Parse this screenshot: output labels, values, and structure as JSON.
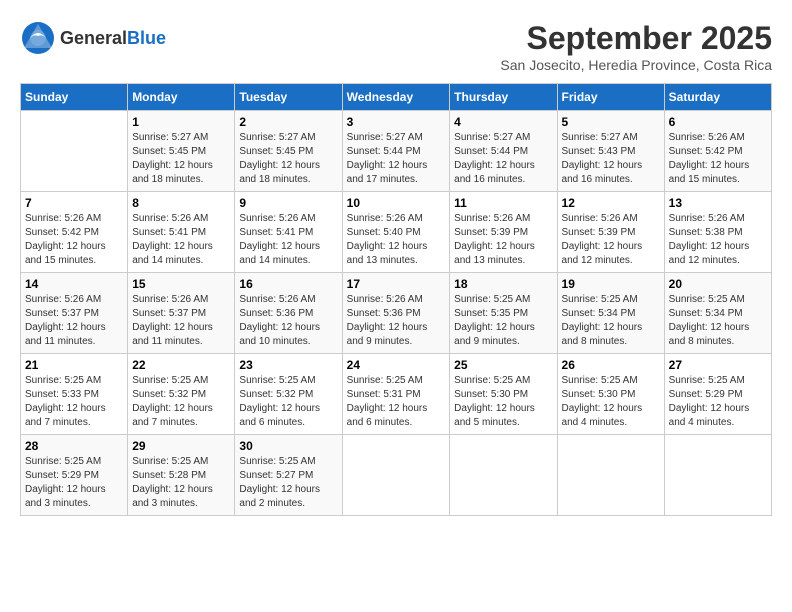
{
  "header": {
    "logo": {
      "text_general": "General",
      "text_blue": "Blue"
    },
    "title": "September 2025",
    "subtitle": "San Josecito, Heredia Province, Costa Rica"
  },
  "calendar": {
    "days_of_week": [
      "Sunday",
      "Monday",
      "Tuesday",
      "Wednesday",
      "Thursday",
      "Friday",
      "Saturday"
    ],
    "weeks": [
      [
        {
          "day": "",
          "info": ""
        },
        {
          "day": "1",
          "info": "Sunrise: 5:27 AM\nSunset: 5:45 PM\nDaylight: 12 hours\nand 18 minutes."
        },
        {
          "day": "2",
          "info": "Sunrise: 5:27 AM\nSunset: 5:45 PM\nDaylight: 12 hours\nand 18 minutes."
        },
        {
          "day": "3",
          "info": "Sunrise: 5:27 AM\nSunset: 5:44 PM\nDaylight: 12 hours\nand 17 minutes."
        },
        {
          "day": "4",
          "info": "Sunrise: 5:27 AM\nSunset: 5:44 PM\nDaylight: 12 hours\nand 16 minutes."
        },
        {
          "day": "5",
          "info": "Sunrise: 5:27 AM\nSunset: 5:43 PM\nDaylight: 12 hours\nand 16 minutes."
        },
        {
          "day": "6",
          "info": "Sunrise: 5:26 AM\nSunset: 5:42 PM\nDaylight: 12 hours\nand 15 minutes."
        }
      ],
      [
        {
          "day": "7",
          "info": "Sunrise: 5:26 AM\nSunset: 5:42 PM\nDaylight: 12 hours\nand 15 minutes."
        },
        {
          "day": "8",
          "info": "Sunrise: 5:26 AM\nSunset: 5:41 PM\nDaylight: 12 hours\nand 14 minutes."
        },
        {
          "day": "9",
          "info": "Sunrise: 5:26 AM\nSunset: 5:41 PM\nDaylight: 12 hours\nand 14 minutes."
        },
        {
          "day": "10",
          "info": "Sunrise: 5:26 AM\nSunset: 5:40 PM\nDaylight: 12 hours\nand 13 minutes."
        },
        {
          "day": "11",
          "info": "Sunrise: 5:26 AM\nSunset: 5:39 PM\nDaylight: 12 hours\nand 13 minutes."
        },
        {
          "day": "12",
          "info": "Sunrise: 5:26 AM\nSunset: 5:39 PM\nDaylight: 12 hours\nand 12 minutes."
        },
        {
          "day": "13",
          "info": "Sunrise: 5:26 AM\nSunset: 5:38 PM\nDaylight: 12 hours\nand 12 minutes."
        }
      ],
      [
        {
          "day": "14",
          "info": "Sunrise: 5:26 AM\nSunset: 5:37 PM\nDaylight: 12 hours\nand 11 minutes."
        },
        {
          "day": "15",
          "info": "Sunrise: 5:26 AM\nSunset: 5:37 PM\nDaylight: 12 hours\nand 11 minutes."
        },
        {
          "day": "16",
          "info": "Sunrise: 5:26 AM\nSunset: 5:36 PM\nDaylight: 12 hours\nand 10 minutes."
        },
        {
          "day": "17",
          "info": "Sunrise: 5:26 AM\nSunset: 5:36 PM\nDaylight: 12 hours\nand 9 minutes."
        },
        {
          "day": "18",
          "info": "Sunrise: 5:25 AM\nSunset: 5:35 PM\nDaylight: 12 hours\nand 9 minutes."
        },
        {
          "day": "19",
          "info": "Sunrise: 5:25 AM\nSunset: 5:34 PM\nDaylight: 12 hours\nand 8 minutes."
        },
        {
          "day": "20",
          "info": "Sunrise: 5:25 AM\nSunset: 5:34 PM\nDaylight: 12 hours\nand 8 minutes."
        }
      ],
      [
        {
          "day": "21",
          "info": "Sunrise: 5:25 AM\nSunset: 5:33 PM\nDaylight: 12 hours\nand 7 minutes."
        },
        {
          "day": "22",
          "info": "Sunrise: 5:25 AM\nSunset: 5:32 PM\nDaylight: 12 hours\nand 7 minutes."
        },
        {
          "day": "23",
          "info": "Sunrise: 5:25 AM\nSunset: 5:32 PM\nDaylight: 12 hours\nand 6 minutes."
        },
        {
          "day": "24",
          "info": "Sunrise: 5:25 AM\nSunset: 5:31 PM\nDaylight: 12 hours\nand 6 minutes."
        },
        {
          "day": "25",
          "info": "Sunrise: 5:25 AM\nSunset: 5:30 PM\nDaylight: 12 hours\nand 5 minutes."
        },
        {
          "day": "26",
          "info": "Sunrise: 5:25 AM\nSunset: 5:30 PM\nDaylight: 12 hours\nand 4 minutes."
        },
        {
          "day": "27",
          "info": "Sunrise: 5:25 AM\nSunset: 5:29 PM\nDaylight: 12 hours\nand 4 minutes."
        }
      ],
      [
        {
          "day": "28",
          "info": "Sunrise: 5:25 AM\nSunset: 5:29 PM\nDaylight: 12 hours\nand 3 minutes."
        },
        {
          "day": "29",
          "info": "Sunrise: 5:25 AM\nSunset: 5:28 PM\nDaylight: 12 hours\nand 3 minutes."
        },
        {
          "day": "30",
          "info": "Sunrise: 5:25 AM\nSunset: 5:27 PM\nDaylight: 12 hours\nand 2 minutes."
        },
        {
          "day": "",
          "info": ""
        },
        {
          "day": "",
          "info": ""
        },
        {
          "day": "",
          "info": ""
        },
        {
          "day": "",
          "info": ""
        }
      ]
    ]
  }
}
